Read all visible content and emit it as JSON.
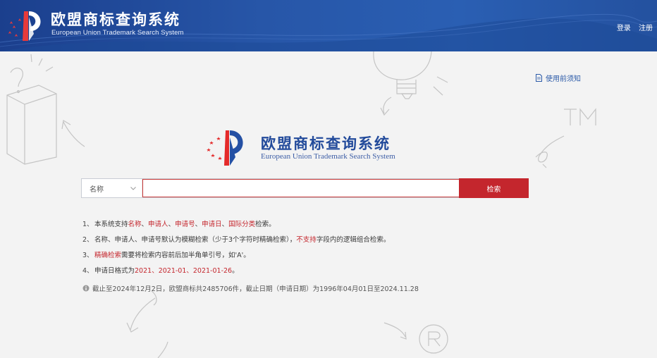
{
  "header": {
    "title": "欧盟商标查询系统",
    "subtitle": "European Union Trademark Search System",
    "login": "登录",
    "register": "注册"
  },
  "help": {
    "label": "使用前须知"
  },
  "center": {
    "title": "欧盟商标查询系统",
    "subtitle": "European Union Trademark Search System"
  },
  "search": {
    "field_selected": "名称",
    "input_value": "",
    "input_placeholder": "",
    "button_label": "检索"
  },
  "notes": [
    {
      "num": "1、",
      "parts": [
        {
          "t": "本系统支持",
          "red": false
        },
        {
          "t": "名称",
          "red": true
        },
        {
          "t": "、",
          "red": false
        },
        {
          "t": "申请人",
          "red": true
        },
        {
          "t": "、",
          "red": false
        },
        {
          "t": "申请号",
          "red": true
        },
        {
          "t": "、",
          "red": false
        },
        {
          "t": "申请日",
          "red": true
        },
        {
          "t": "、",
          "red": false
        },
        {
          "t": "国际分类",
          "red": true
        },
        {
          "t": "检索。",
          "red": false
        }
      ]
    },
    {
      "num": "2、",
      "parts": [
        {
          "t": "名称、申请人、申请号默认为模糊检索（少于3个字符时精确检索），",
          "red": false
        },
        {
          "t": "不支持",
          "red": true
        },
        {
          "t": "字段内的逻辑组合检索。",
          "red": false
        }
      ]
    },
    {
      "num": "3、",
      "parts": [
        {
          "t": "精确检索",
          "red": true
        },
        {
          "t": "需要将检索内容前后加半角单引号，如'A'。",
          "red": false
        }
      ]
    },
    {
      "num": "4、",
      "parts": [
        {
          "t": "申请日格式为",
          "red": false
        },
        {
          "t": "2021、2021-01、2021-01-26",
          "red": true
        },
        {
          "t": "。",
          "red": false
        }
      ]
    }
  ],
  "stat": {
    "text": "截止至2024年12月2日，欧盟商标共2485706件，截止日期（申请日期）为1996年04月01日至2024.11.28"
  },
  "colors": {
    "header_blue": "#2756a8",
    "brand_red": "#c4262d",
    "brand_blue": "#234b9b"
  },
  "icons": {
    "logo": "eu-trademark-logo",
    "help": "document-icon",
    "select": "chevron-down-icon",
    "stat": "info-icon"
  }
}
